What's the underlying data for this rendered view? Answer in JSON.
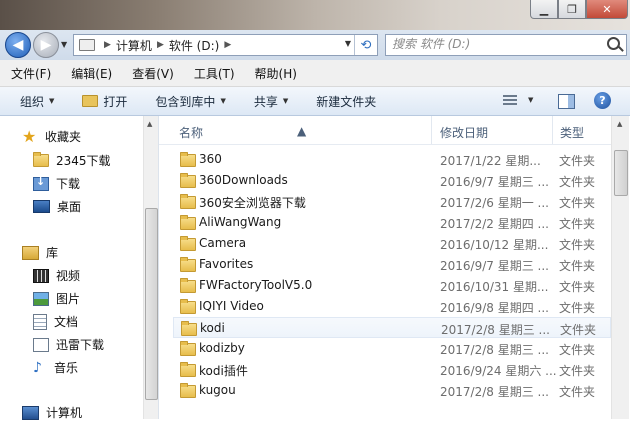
{
  "address": {
    "breadcrumbs": [
      "计算机",
      "软件 (D:)"
    ]
  },
  "search": {
    "placeholder": "搜索 软件 (D:)"
  },
  "menu": [
    "文件(F)",
    "编辑(E)",
    "查看(V)",
    "工具(T)",
    "帮助(H)"
  ],
  "commands": {
    "organize": "组织",
    "open": "打开",
    "include_in_library": "包含到库中",
    "share": "共享",
    "new_folder": "新建文件夹"
  },
  "nav": {
    "favorites_header": "收藏夹",
    "favorites": [
      "2345下载",
      "下载",
      "桌面"
    ],
    "library_header": "库",
    "libraries": [
      "视频",
      "图片",
      "文档",
      "迅雷下载",
      "音乐"
    ],
    "computer": "计算机"
  },
  "columns": {
    "name": "名称",
    "date": "修改日期",
    "type": "类型"
  },
  "files": [
    {
      "name": "360",
      "date": "2017/1/22 星期...",
      "type": "文件夹"
    },
    {
      "name": "360Downloads",
      "date": "2016/9/7 星期三 ...",
      "type": "文件夹"
    },
    {
      "name": "360安全浏览器下载",
      "date": "2017/2/6 星期一 ...",
      "type": "文件夹"
    },
    {
      "name": "AliWangWang",
      "date": "2017/2/2 星期四 ...",
      "type": "文件夹"
    },
    {
      "name": "Camera",
      "date": "2016/10/12 星期...",
      "type": "文件夹"
    },
    {
      "name": "Favorites",
      "date": "2016/9/7 星期三 ...",
      "type": "文件夹"
    },
    {
      "name": "FWFactoryToolV5.0",
      "date": "2016/10/31 星期...",
      "type": "文件夹"
    },
    {
      "name": "IQIYI Video",
      "date": "2016/9/8 星期四 ...",
      "type": "文件夹"
    },
    {
      "name": "kodi",
      "date": "2017/2/8 星期三 ...",
      "type": "文件夹"
    },
    {
      "name": "kodizby",
      "date": "2017/2/8 星期三 ...",
      "type": "文件夹"
    },
    {
      "name": "kodi插件",
      "date": "2016/9/24 星期六 ...",
      "type": "文件夹"
    },
    {
      "name": "kugou",
      "date": "2017/2/8 星期三 ...",
      "type": "文件夹"
    }
  ]
}
